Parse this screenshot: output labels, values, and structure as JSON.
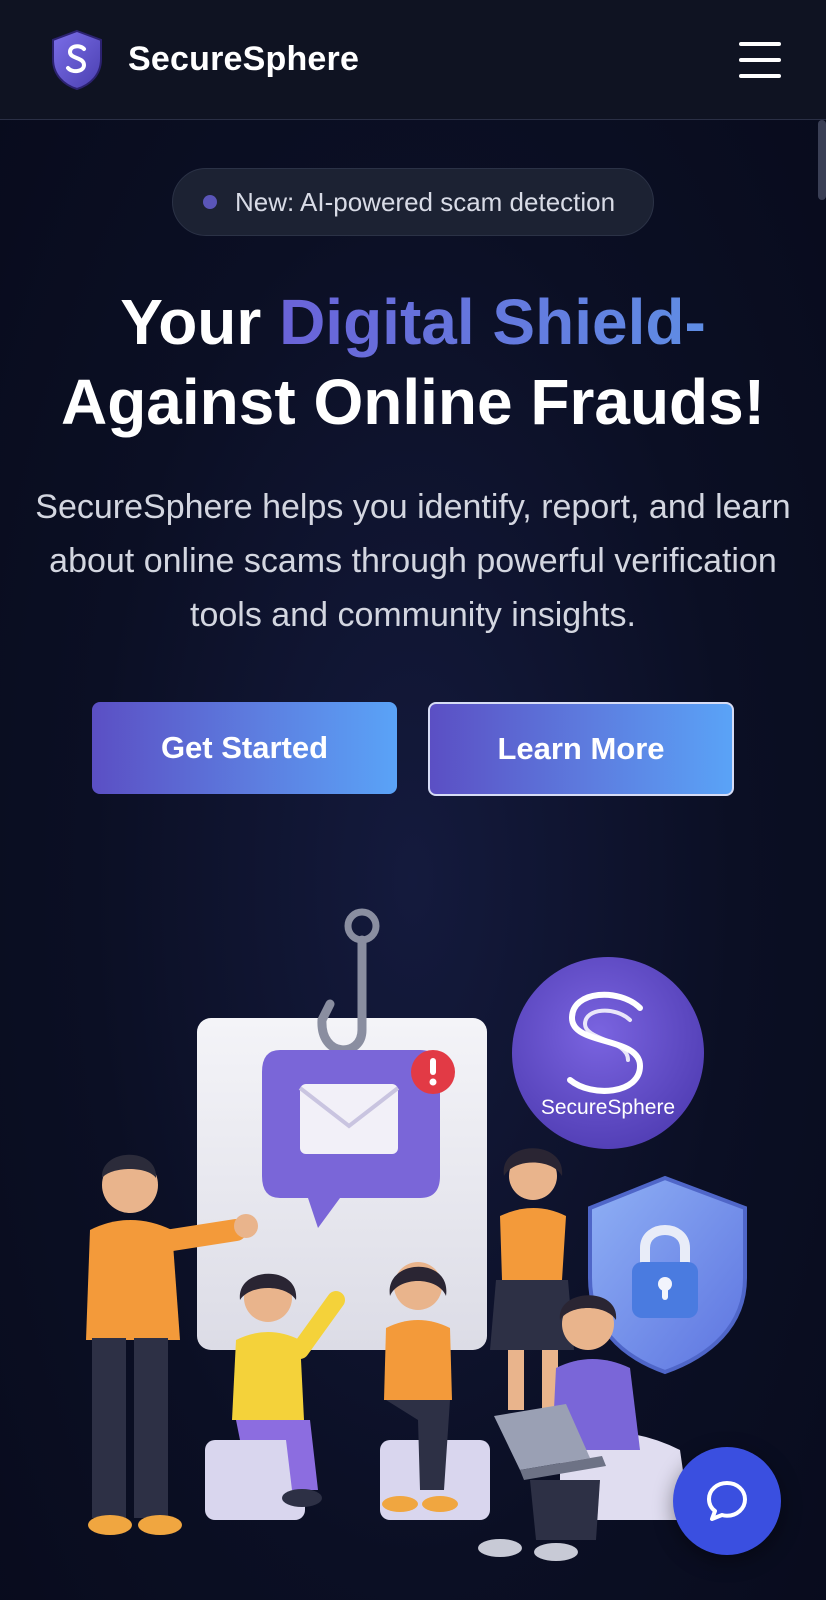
{
  "header": {
    "brand": "SecureSphere",
    "logo_icon": "shield-s-logo-icon",
    "menu_icon": "hamburger-menu-icon"
  },
  "badge": {
    "text": "New: AI-powered scam detection"
  },
  "hero": {
    "headline_part1": "Your ",
    "headline_accent": "Digital Shield-",
    "headline_part2": "Against Online Frauds!",
    "subtitle": "SecureSphere helps you identify, report, and learn about online scams through powerful verification tools and community insights."
  },
  "buttons": {
    "primary_label": "Get Started",
    "secondary_label": "Learn More"
  },
  "illustration": {
    "logo_text": "SecureSphere"
  },
  "chat": {
    "icon": "chat-bubble-icon"
  },
  "colors": {
    "accent_start": "#6a63d8",
    "accent_end": "#5aa3f7",
    "chat_button": "#3a4fe0"
  }
}
